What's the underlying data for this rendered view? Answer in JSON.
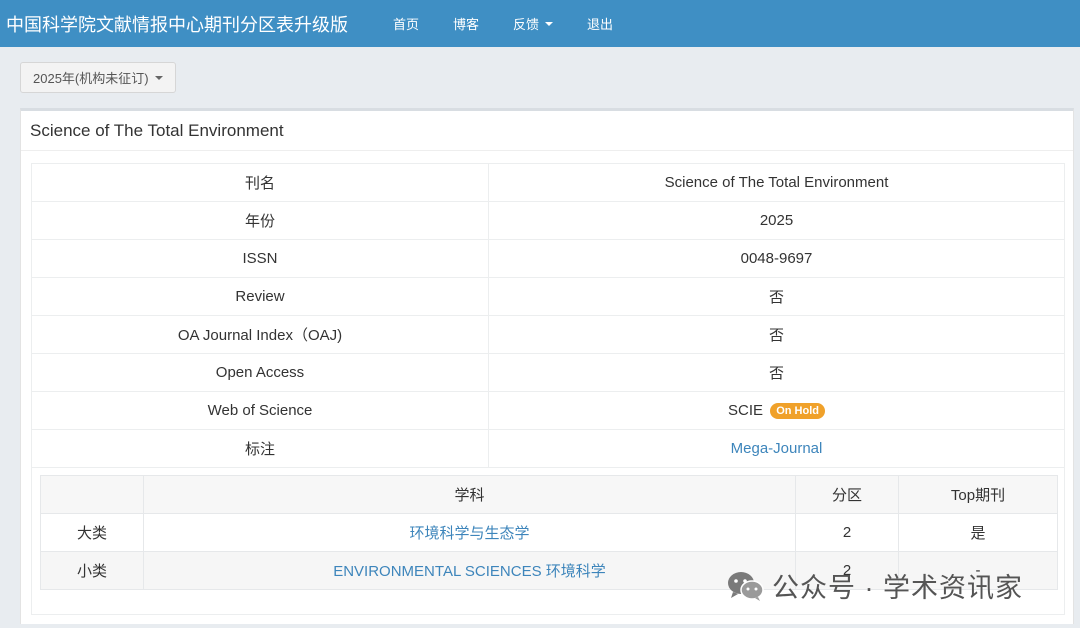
{
  "navbar": {
    "brand": "中国科学院文献情报中心期刊分区表升级版",
    "links": [
      "首页",
      "博客",
      "反馈",
      "退出"
    ]
  },
  "year_select": {
    "label": "2025年(机构未征订)"
  },
  "panel": {
    "title": "Science of The Total Environment",
    "info_rows": [
      {
        "label": "刊名",
        "value": "Science of The Total Environment"
      },
      {
        "label": "年份",
        "value": "2025"
      },
      {
        "label": "ISSN",
        "value": "0048-9697"
      },
      {
        "label": "Review",
        "value": "否"
      },
      {
        "label": "OA Journal Index（OAJ)",
        "value": "否"
      },
      {
        "label": "Open Access",
        "value": "否"
      },
      {
        "label": "Web of Science",
        "value": "SCIE",
        "badge": "On Hold"
      },
      {
        "label": "标注",
        "value": "Mega-Journal"
      }
    ],
    "category_table": {
      "headers": [
        "",
        "学科",
        "分区",
        "Top期刊"
      ],
      "rows": [
        {
          "type": "大类",
          "subject": "环境科学与生态学",
          "zone": "2",
          "top": "是"
        },
        {
          "type": "小类",
          "subject": "ENVIRONMENTAL SCIENCES 环境科学",
          "zone": "2",
          "top": "-"
        }
      ]
    }
  },
  "watermark": {
    "text": "公众号 · 学术资讯家"
  },
  "colors": {
    "navbar": "#3f8fc4",
    "link": "#3d85bb",
    "badge": "#f0a12a"
  }
}
